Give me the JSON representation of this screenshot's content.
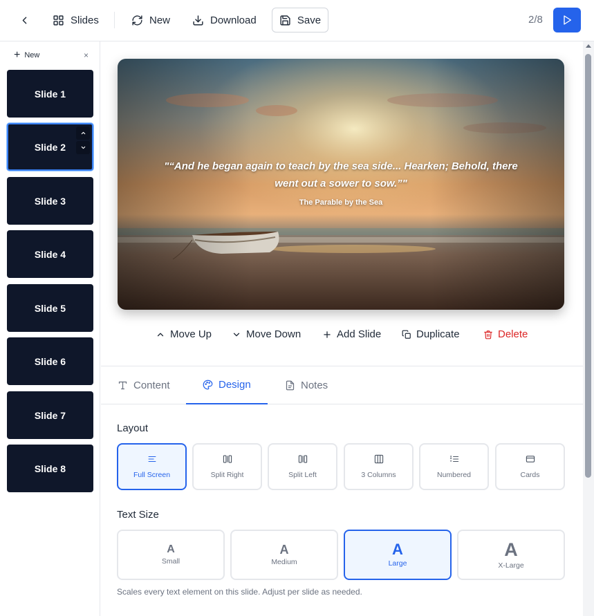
{
  "topbar": {
    "slides_label": "Slides",
    "new_label": "New",
    "download_label": "Download",
    "save_label": "Save",
    "pager": "2/8",
    "accent": "#2563eb"
  },
  "sidebar": {
    "new_label": "New",
    "close_glyph": "×",
    "slides": [
      {
        "label": "Slide 1"
      },
      {
        "label": "Slide 2"
      },
      {
        "label": "Slide 3"
      },
      {
        "label": "Slide 4"
      },
      {
        "label": "Slide 5"
      },
      {
        "label": "Slide 6"
      },
      {
        "label": "Slide 7"
      },
      {
        "label": "Slide 8"
      }
    ],
    "active_index": 1
  },
  "preview": {
    "quote": "\"“And he began again to teach by the sea side... Hearken; Behold, there went out a sower to sow.”\"",
    "attribution": "The Parable by the Sea"
  },
  "actions": {
    "move_up": "Move Up",
    "move_down": "Move Down",
    "add_slide": "Add Slide",
    "duplicate": "Duplicate",
    "delete": "Delete"
  },
  "tabs": {
    "content": "Content",
    "design": "Design",
    "notes": "Notes",
    "active": "Design"
  },
  "design": {
    "layout_title": "Layout",
    "layouts": [
      {
        "label": "Full Screen",
        "icon": "align-left-icon"
      },
      {
        "label": "Split Right",
        "icon": "split-right-icon"
      },
      {
        "label": "Split Left",
        "icon": "split-left-icon"
      },
      {
        "label": "3 Columns",
        "icon": "columns-icon"
      },
      {
        "label": "Numbered",
        "icon": "numbered-list-icon"
      },
      {
        "label": "Cards",
        "icon": "card-icon"
      }
    ],
    "layout_selected": "Full Screen",
    "text_size_title": "Text Size",
    "sizes": [
      {
        "glyph": "A",
        "label": "Small"
      },
      {
        "glyph": "A",
        "label": "Medium"
      },
      {
        "glyph": "A",
        "label": "Large"
      },
      {
        "glyph": "A",
        "label": "X-Large"
      }
    ],
    "size_selected": "Large",
    "hint": "Scales every text element on this slide. Adjust per slide as needed."
  }
}
